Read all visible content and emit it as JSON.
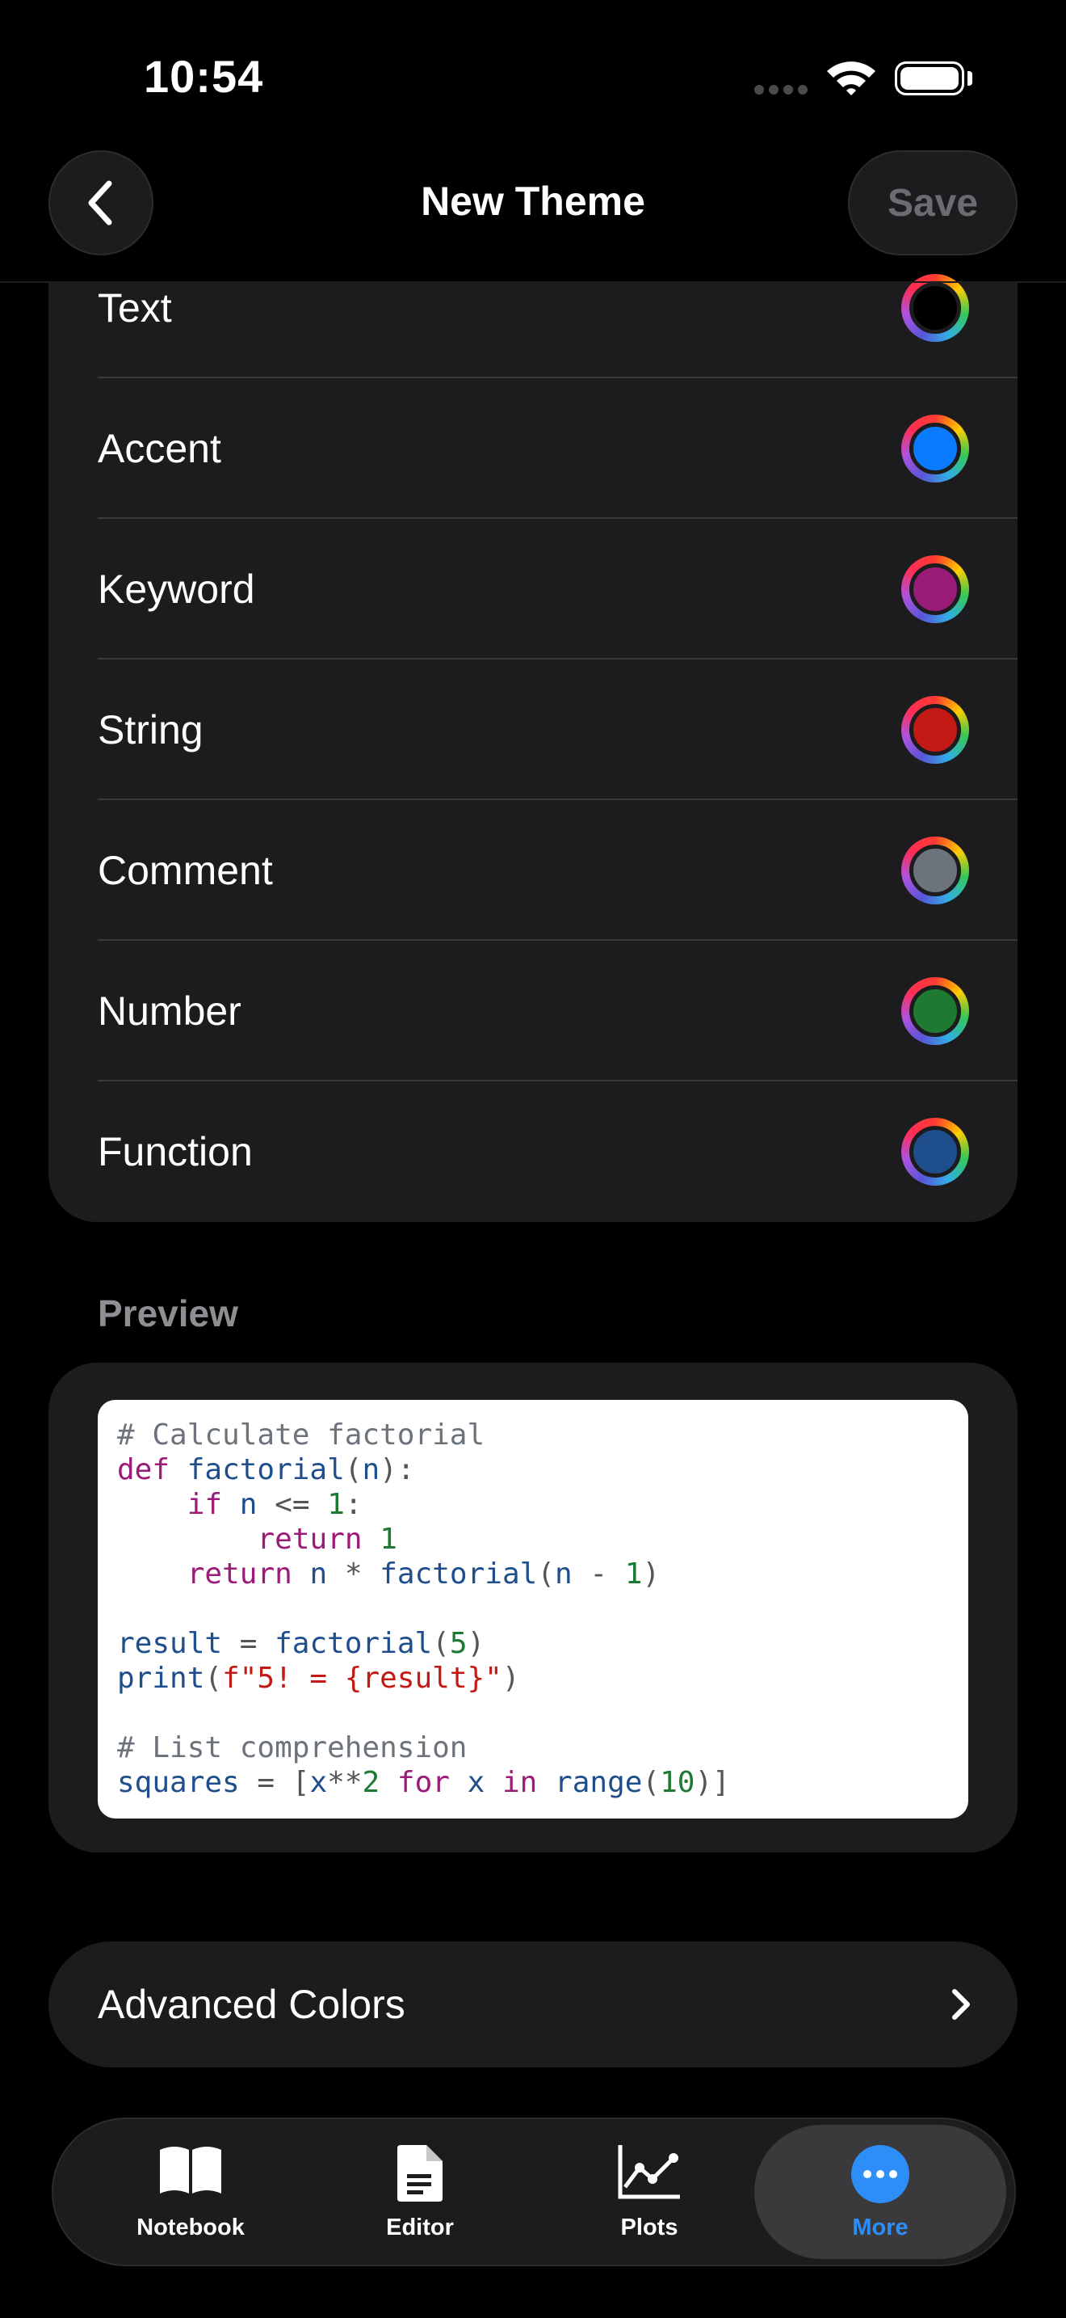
{
  "status_bar": {
    "time": "10:54"
  },
  "nav": {
    "title": "New Theme",
    "save_label": "Save"
  },
  "colors": [
    {
      "label": "Text",
      "color": "#000000"
    },
    {
      "label": "Accent",
      "color": "#0a7aff"
    },
    {
      "label": "Keyword",
      "color": "#9b1b78"
    },
    {
      "label": "String",
      "color": "#c41a16"
    },
    {
      "label": "Comment",
      "color": "#6c737b"
    },
    {
      "label": "Number",
      "color": "#1e7a33"
    },
    {
      "label": "Function",
      "color": "#1e4e8c"
    }
  ],
  "preview": {
    "header": "Preview",
    "code_lines": [
      "# Calculate factorial",
      "def factorial(n):",
      "    if n <= 1:",
      "        return 1",
      "    return n * factorial(n - 1)",
      "",
      "result = factorial(5)",
      "print(f\"5! = {result}\")",
      "",
      "# List comprehension",
      "squares = [x**2 for x in range(10)]"
    ]
  },
  "advanced": {
    "label": "Advanced Colors"
  },
  "tabs": [
    {
      "label": "Notebook",
      "icon": "book-icon",
      "active": false
    },
    {
      "label": "Editor",
      "icon": "document-icon",
      "active": false
    },
    {
      "label": "Plots",
      "icon": "chart-icon",
      "active": false
    },
    {
      "label": "More",
      "icon": "more-icon",
      "active": true
    }
  ],
  "accent_color": "#2e8ef7"
}
